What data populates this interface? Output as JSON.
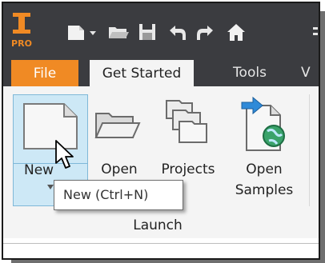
{
  "app": {
    "logo_text": "PRO",
    "brand_color": "#f08a24"
  },
  "quick_access": {
    "icons": [
      "new-document-icon",
      "dropdown-arrow-icon",
      "open-folder-icon",
      "save-icon",
      "undo-icon",
      "redo-icon",
      "home-icon"
    ]
  },
  "tabs": [
    {
      "label": "File"
    },
    {
      "label": "Get Started"
    },
    {
      "label": "Tools"
    },
    {
      "label": "V"
    }
  ],
  "ribbon": {
    "panel_title": "Launch",
    "buttons": {
      "new": {
        "label": "New"
      },
      "open": {
        "label": "Open"
      },
      "projects": {
        "label": "Projects"
      },
      "open_samples": {
        "label_line1": "Open",
        "label_line2": "Samples"
      }
    },
    "tooltip": "New (Ctrl+N)"
  },
  "colors": {
    "hover_fill": "#cde8f6",
    "hover_border": "#7fb8d8",
    "dark_bar": "#3b3c40"
  }
}
